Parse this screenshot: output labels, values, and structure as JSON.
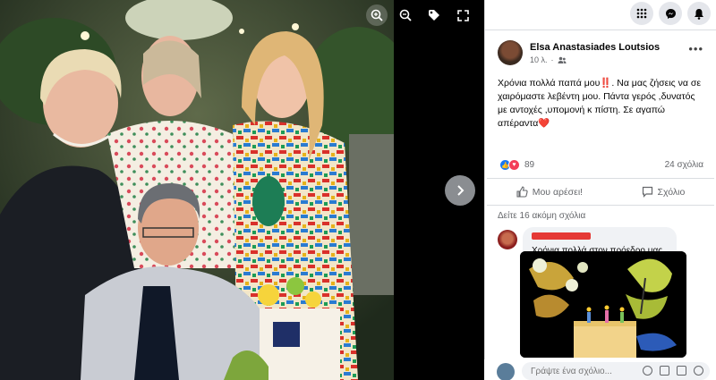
{
  "post": {
    "author": "Elsa Anastasiades Loutsios",
    "time": "10 λ.",
    "text": "Χρόνια πολλά παπά μου‼️. Να μας ζήσεις να σε χαιρόμαστε λεβέντη μου. Πάντα γερός ,δυνατός με αντοχές ,υπομονή κ πίστη. Σε αγαπώ απέραντα❤️",
    "reaction_count": "89",
    "comment_count": "24 σχόλια",
    "like_label": "Μου αρέσει!",
    "comment_label": "Σχόλιο"
  },
  "comments": {
    "more_label": "Δείτε 16 ακόμη σχόλια",
    "first": {
      "text": "Χρόνια πολλά στον πρόεδρο μας, Πολύχρονος..!!!"
    }
  },
  "composer": {
    "placeholder": "Γράψτε ένα σχόλιο..."
  },
  "icons": {
    "zoom_in": "zoom-in-icon",
    "zoom_out": "zoom-out-icon",
    "tag": "tag-icon",
    "fullscreen": "fullscreen-icon",
    "next": "chevron-right-icon",
    "menu": "grid-menu-icon",
    "messenger": "messenger-icon",
    "notifications": "bell-icon"
  },
  "colors": {
    "facebook_blue": "#1877f2",
    "love_red": "#f33e58",
    "secondary_text": "#65676b"
  }
}
